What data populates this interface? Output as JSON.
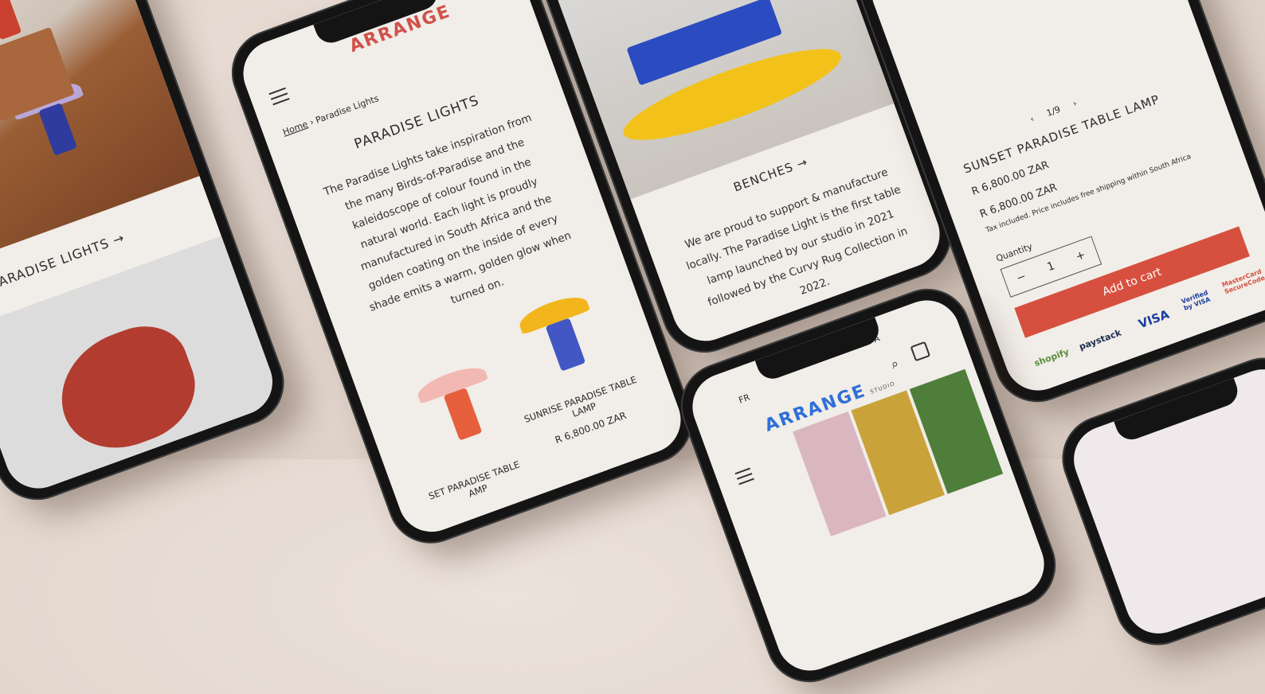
{
  "phone1": {
    "link": "PARADISE LIGHTS →"
  },
  "phone2": {
    "logo": "ARRANGE",
    "breadcrumb_home": "Home",
    "breadcrumb_sep": "›",
    "breadcrumb_current": "Paradise Lights",
    "title": "PARADISE LIGHTS",
    "description": "The Paradise Lights take inspiration from the many Birds-of-Paradise and the kaleidoscope of colour found in the natural world. Each light is proudly manufactured in South Africa and the golden coating on the inside of every shade emits a warm, golden glow when turned on.",
    "product1_name": "SET PARADISE TABLE AMP",
    "product2_name": "SUNRISE PARADISE TABLE LAMP",
    "product2_price": "R 6,800.00 ZAR"
  },
  "phone3": {
    "link": "BENCHES →",
    "text": "We are proud to support & manufacture locally. The Paradise Light is the first table lamp launched by our studio in 2021 followed by the Curvy Rug Collection in 2022."
  },
  "phone4": {
    "pagination": "1/9",
    "prev": "‹",
    "next": "›",
    "title": "SUNSET PARADISE TABLE LAMP",
    "price_old": "R 6,800.00 ZAR",
    "price": "R 6,800.00 ZAR",
    "tax_note": "Tax included. Price includes free shipping within South Africa",
    "quantity_label": "Quantity",
    "quantity_value": "1",
    "minus": "−",
    "plus": "+",
    "add_to_cart": "Add to cart",
    "payments": [
      "shopify",
      "paystack",
      "VISA",
      "Verified by VISA",
      "MasterCard SecureCode"
    ]
  },
  "phone5": {
    "logo": "ARRANGE",
    "logo_sub": "STUDIO",
    "announce": "FR",
    "announce_end": "A"
  }
}
